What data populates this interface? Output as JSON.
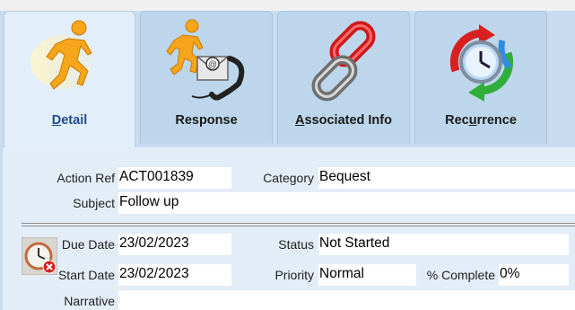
{
  "tabs": [
    {
      "label": "Detail",
      "mnemonic": "D",
      "rest": "etail",
      "icon": "running-man-icon",
      "active": true
    },
    {
      "label": "Response",
      "icon": "running-man-mail-phone-icon",
      "active": false
    },
    {
      "label": "Associated Info",
      "mnemonic": "A",
      "rest": "ssociated Info",
      "icon": "chain-link-icon",
      "active": false
    },
    {
      "label": "Recurrence",
      "pre": "Rec",
      "mnemonic": "u",
      "rest": "rrence",
      "icon": "clock-arrows-icon",
      "active": false
    }
  ],
  "form": {
    "action_ref": {
      "label": "Action Ref",
      "value": "ACT001839"
    },
    "category": {
      "label": "Category",
      "value": "Bequest"
    },
    "subject": {
      "label": "Subject",
      "value": "Follow up"
    },
    "due_date": {
      "label": "Due Date",
      "value": "23/02/2023"
    },
    "start_date": {
      "label": "Start Date",
      "value": "23/02/2023"
    },
    "status": {
      "label": "Status",
      "value": "Not Started"
    },
    "priority": {
      "label": "Priority",
      "value": "Normal"
    },
    "percent_complete": {
      "label": "% Complete",
      "value": "0%"
    },
    "narrative": {
      "label": "Narrative",
      "value": ""
    }
  },
  "alarm_icon": "alarm-clock-cancel-icon"
}
